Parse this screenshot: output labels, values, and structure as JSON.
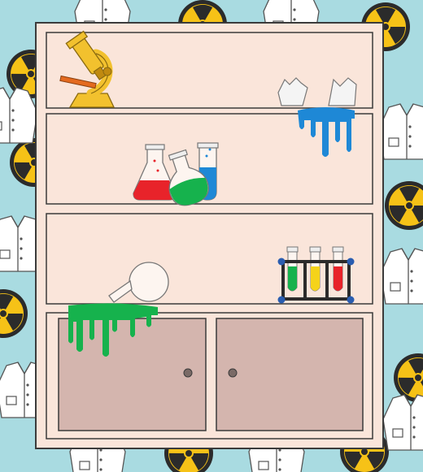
{
  "scene": {
    "kind": "escape-room-lab-shelf",
    "colors": {
      "background": "#a9dbe1",
      "shelf_panel": "#fae5da",
      "shelf_outline": "#3b3b3b",
      "cabinet_door": "#d4b5ae",
      "radiation_yellow": "#f6c217",
      "radiation_black": "#2b2b2b",
      "green_liquid": "#16b24d",
      "blue_liquid": "#1e88d6",
      "red_liquid": "#e8232a",
      "yellow_liquid": "#f5d31a",
      "microscope": "#f2c12e"
    },
    "shelves": [
      {
        "name": "top-shelf",
        "items": [
          "microscope",
          "broken-beaker-blue-spill"
        ]
      },
      {
        "name": "second-shelf",
        "items": [
          "red-flask",
          "green-flask",
          "blue-test-tube"
        ]
      },
      {
        "name": "third-shelf",
        "items": [
          "tipped-round-flask",
          "test-tube-rack"
        ]
      }
    ],
    "cabinet": {
      "doors": [
        "left-cabinet-door",
        "right-cabinet-door"
      ],
      "spill": "green-spill"
    },
    "test_tube_rack": {
      "tubes": [
        "green",
        "yellow",
        "red"
      ]
    },
    "background_pattern": [
      "lab-coat-icon",
      "radiation-icon"
    ]
  }
}
